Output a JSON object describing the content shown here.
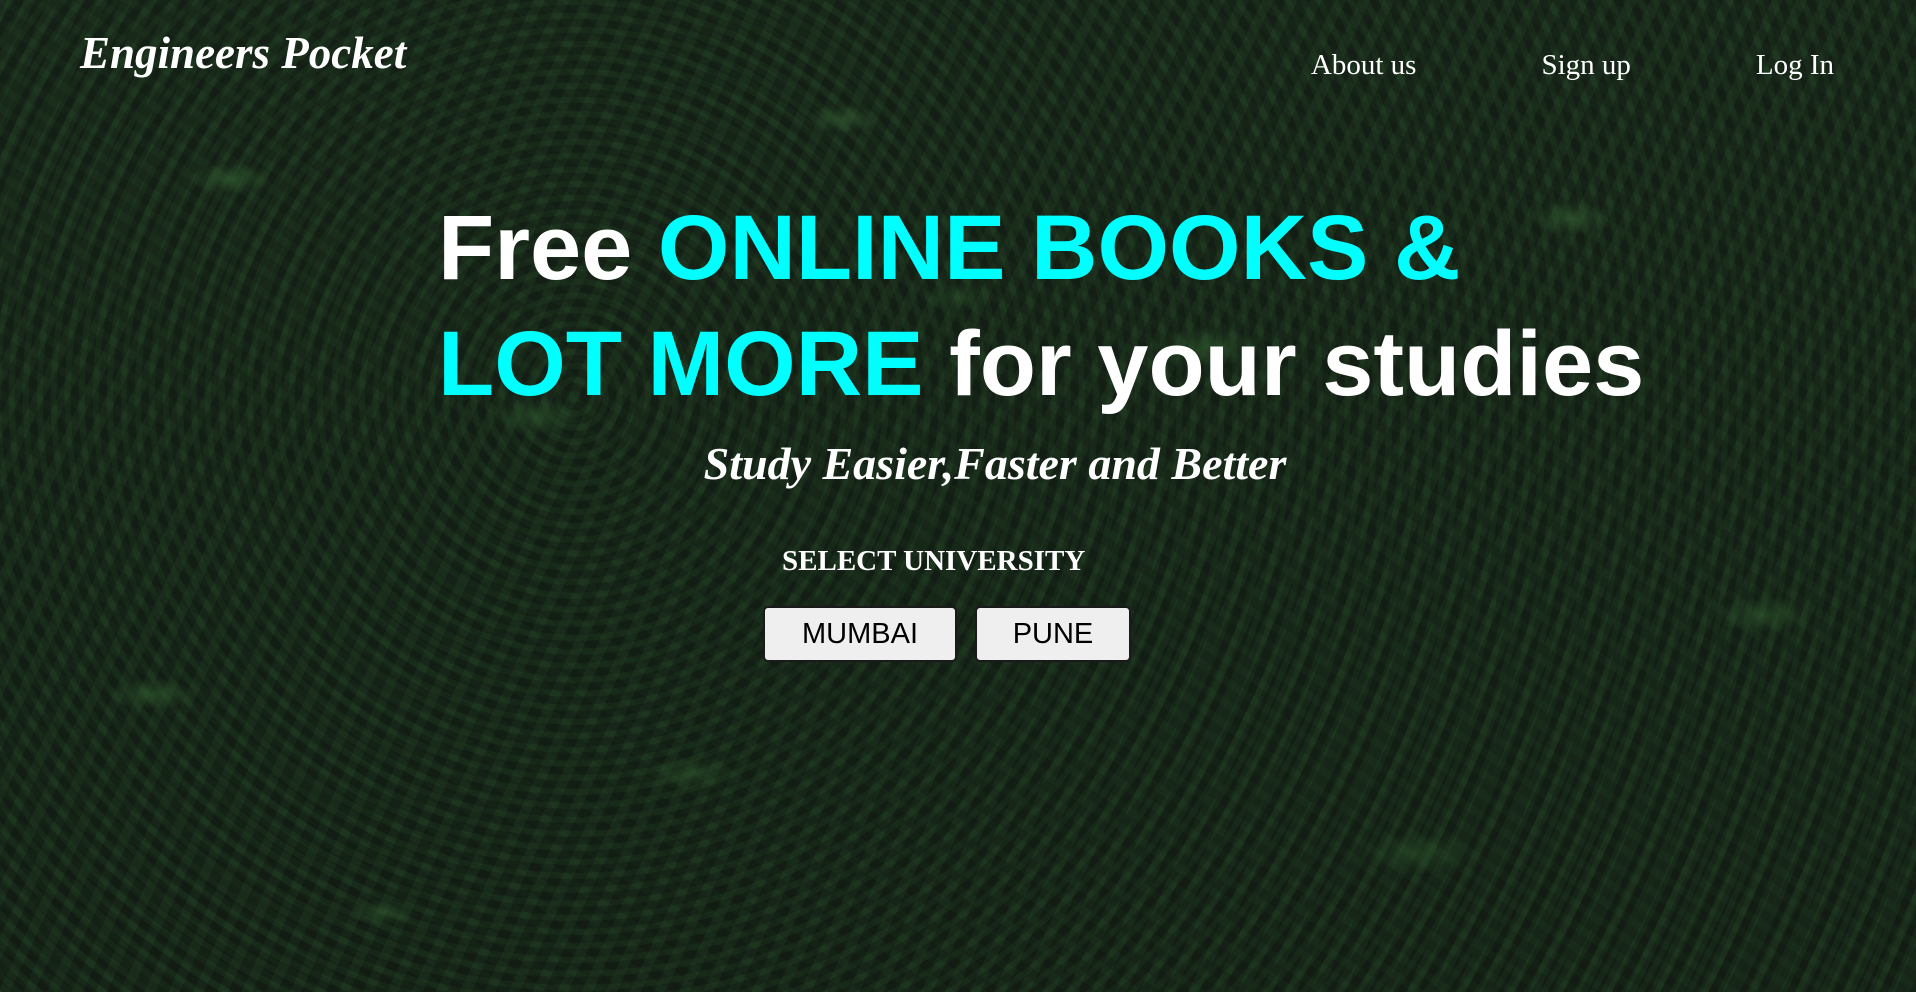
{
  "header": {
    "logo": "Engineers Pocket",
    "nav": [
      {
        "label": "About us"
      },
      {
        "label": "Sign up"
      },
      {
        "label": "Log In"
      }
    ]
  },
  "hero": {
    "headline_line1_plain": "Free ",
    "headline_line1_accent": "ONLINE BOOKS &",
    "headline_line2_accent": "LOT MORE",
    "headline_line2_plain": " for your studies",
    "tagline": "Study Easier,Faster and Better"
  },
  "university": {
    "label": "SELECT UNIVERSITY",
    "options": [
      {
        "label": "MUMBAI"
      },
      {
        "label": "PUNE"
      }
    ]
  },
  "colors": {
    "accent": "#00ffff",
    "text": "#ffffff",
    "button_bg": "#efefef",
    "background": "#1b2a1e"
  }
}
